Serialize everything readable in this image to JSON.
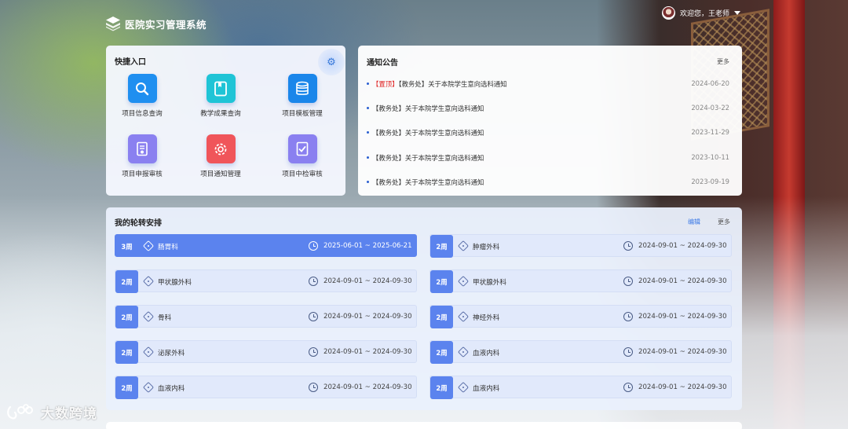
{
  "header": {
    "app_title": "医院实习管理系统",
    "user_greeting": "欢迎您，王老师"
  },
  "quick": {
    "title": "快捷入口",
    "settings_icon": "gear-icon",
    "items": [
      {
        "label": "项目信息查询",
        "icon": "search-icon",
        "color": "#1f8ff0"
      },
      {
        "label": "教学成果查询",
        "icon": "book-icon",
        "color": "#1fc4d6"
      },
      {
        "label": "项目模板管理",
        "icon": "database-icon",
        "color": "#1a86ea"
      },
      {
        "label": "项目申报审核",
        "icon": "report-icon",
        "color": "#8a80f0"
      },
      {
        "label": "项目通知管理",
        "icon": "gear-notice-icon",
        "color": "#f0555a"
      },
      {
        "label": "项目中检审核",
        "icon": "check-document-icon",
        "color": "#8a80f0"
      }
    ]
  },
  "notice": {
    "title": "通知公告",
    "more": "更多",
    "items": [
      {
        "pin": "【置顶】",
        "text": "【教务处】关于本院学生意向选科通知",
        "date": "2024-06-20"
      },
      {
        "pin": "",
        "text": "【教务处】关于本院学生意向选科通知",
        "date": "2024-03-22"
      },
      {
        "pin": "",
        "text": "【教务处】关于本院学生意向选科通知",
        "date": "2023-11-29"
      },
      {
        "pin": "",
        "text": "【教务处】关于本院学生意向选科通知",
        "date": "2023-10-11"
      },
      {
        "pin": "",
        "text": "【教务处】关于本院学生意向选科通知",
        "date": "2023-09-19"
      }
    ]
  },
  "rotation": {
    "title": "我的轮转安排",
    "edit": "编辑",
    "more": "更多",
    "items": [
      {
        "weeks": "3周",
        "dept": "肠胃科",
        "range": "2025-06-01 ~ 2025-06-21",
        "active": true
      },
      {
        "weeks": "2周",
        "dept": "肿瘤外科",
        "range": "2024-09-01 ~ 2024-09-30"
      },
      {
        "weeks": "2周",
        "dept": "甲状腺外科",
        "range": "2024-09-01 ~ 2024-09-30"
      },
      {
        "weeks": "2周",
        "dept": "甲状腺外科",
        "range": "2024-09-01 ~ 2024-09-30"
      },
      {
        "weeks": "2周",
        "dept": "骨科",
        "range": "2024-09-01 ~ 2024-09-30"
      },
      {
        "weeks": "2周",
        "dept": "神经外科",
        "range": "2024-09-01 ~ 2024-09-30"
      },
      {
        "weeks": "2周",
        "dept": "泌尿外科",
        "range": "2024-09-01 ~ 2024-09-30"
      },
      {
        "weeks": "2周",
        "dept": "血液内科",
        "range": "2024-09-01 ~ 2024-09-30"
      },
      {
        "weeks": "2周",
        "dept": "血液内科",
        "range": "2024-09-01 ~ 2024-09-30"
      },
      {
        "weeks": "2周",
        "dept": "血液内科",
        "range": "2024-09-01 ~ 2024-09-30"
      }
    ]
  },
  "watermark": {
    "text": "大数跨境"
  }
}
